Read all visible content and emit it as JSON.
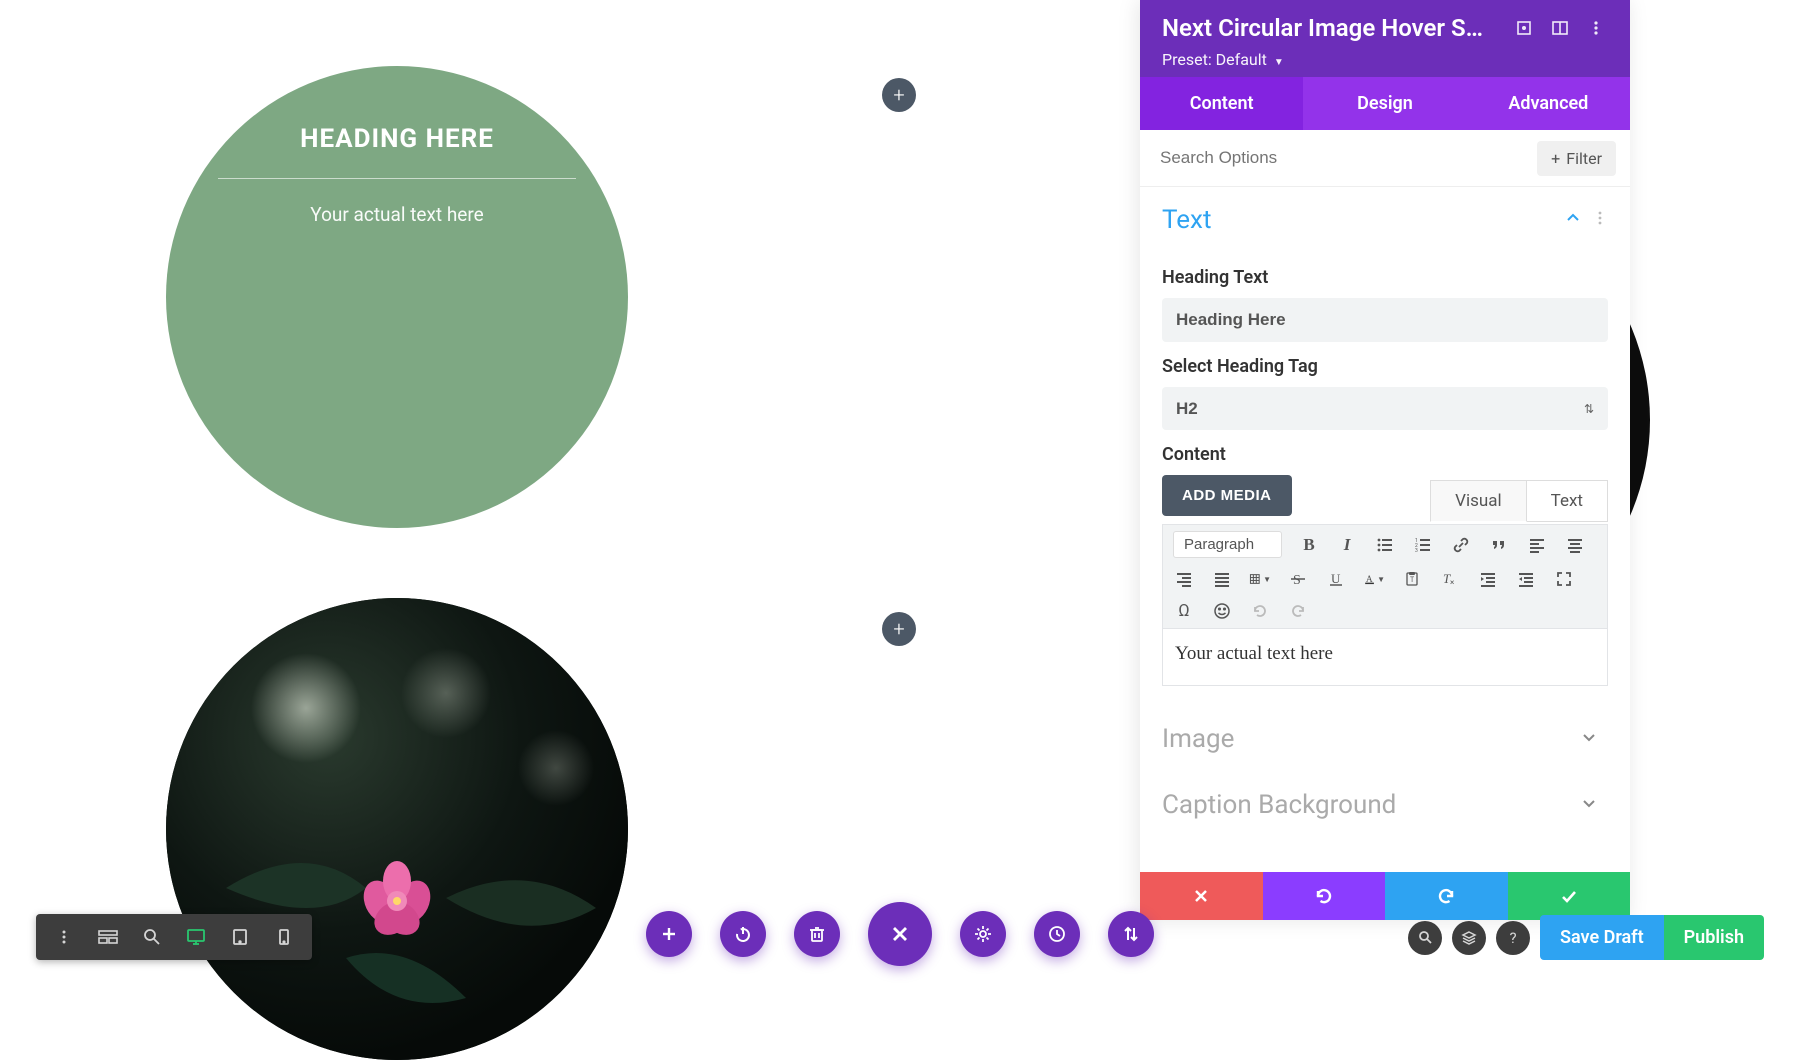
{
  "canvas": {
    "circle1": {
      "heading": "HEADING HERE",
      "subtext": "Your actual text here"
    },
    "addButtonGlyph": "+"
  },
  "panel": {
    "title": "Next Circular Image Hover S…",
    "presetPrefix": "Preset:",
    "presetValue": "Default",
    "tabs": {
      "content": "Content",
      "design": "Design",
      "advanced": "Advanced"
    },
    "searchPlaceholder": "Search Options",
    "filterLabel": "Filter",
    "sections": {
      "text": {
        "title": "Text",
        "headingLabel": "Heading Text",
        "headingValue": "Heading Here",
        "tagLabel": "Select Heading Tag",
        "tagValue": "H2",
        "contentLabel": "Content",
        "addMedia": "ADD MEDIA",
        "editorTabs": {
          "visual": "Visual",
          "text": "Text"
        },
        "paragraphLabel": "Paragraph",
        "editorContent": "Your actual text here"
      },
      "image": {
        "title": "Image"
      },
      "captionBg": {
        "title": "Caption Background"
      }
    }
  },
  "bottomRight": {
    "saveDraft": "Save Draft",
    "publish": "Publish"
  }
}
